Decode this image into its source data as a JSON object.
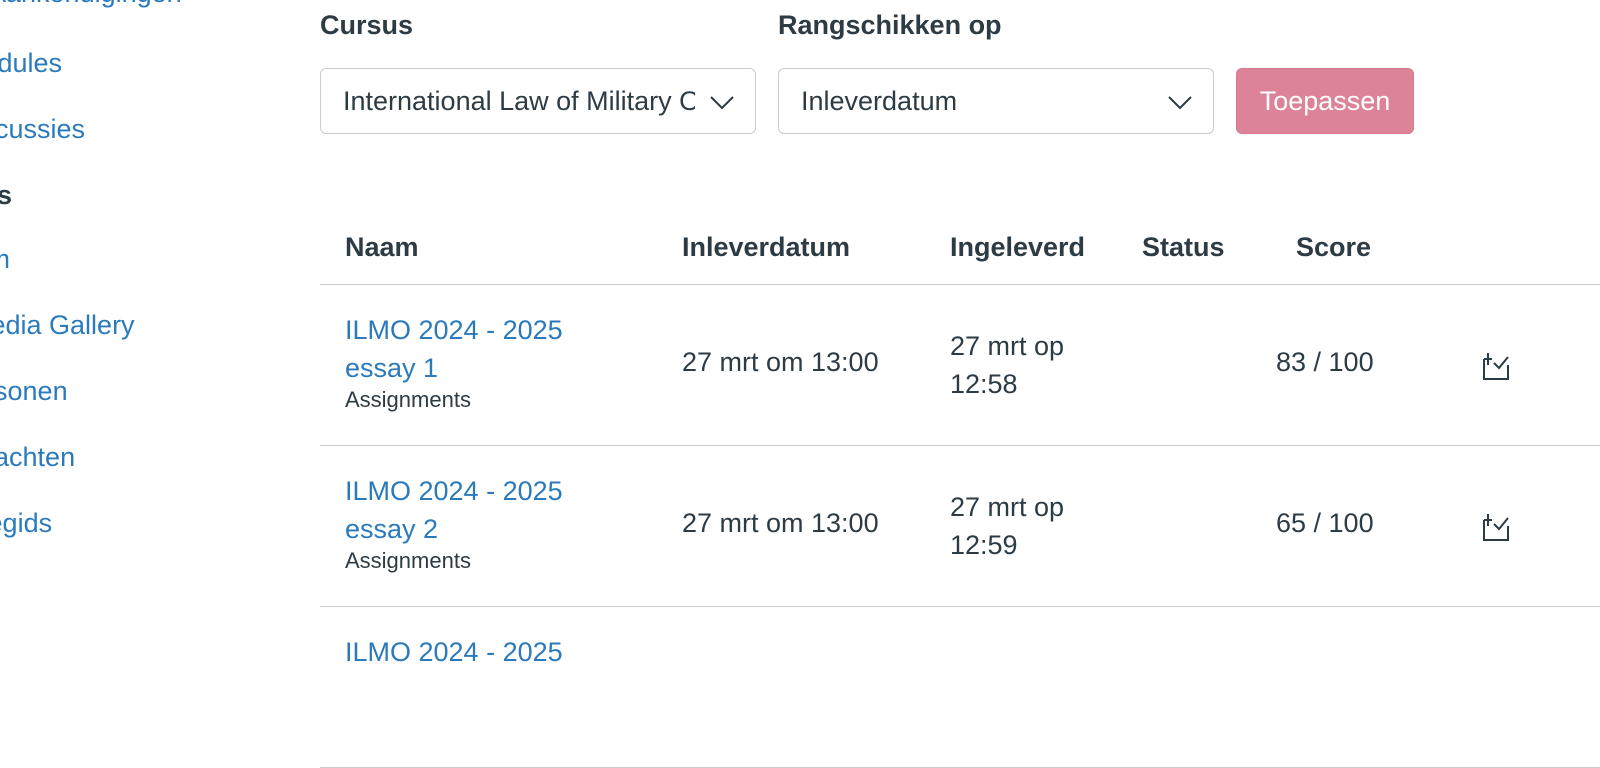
{
  "sidenav": {
    "items": [
      {
        "label": "Aankondigingen"
      },
      {
        "label": "Modules"
      },
      {
        "label": "Discussies"
      },
      {
        "label": "Cijfers"
      },
      {
        "label": "Team"
      },
      {
        "label": "Media Gallery"
      },
      {
        "label": "Personen"
      },
      {
        "label": "Opdrachten"
      },
      {
        "label": "Studiegids"
      }
    ]
  },
  "filters": {
    "course_label": "Cursus",
    "course_value": "International Law of Military Operations",
    "sort_label": "Rangschikken op",
    "sort_value": "Inleverdatum",
    "apply_label": "Toepassen"
  },
  "table": {
    "headers": [
      "Naam",
      "Inleverdatum",
      "Ingeleverd",
      "Status",
      "Score"
    ],
    "rows": [
      {
        "name": "ILMO 2024 - 2025 essay 1",
        "group": "Assignments",
        "due": "27 mrt om 13:00",
        "submitted": "27 mrt op 12:58",
        "status": "",
        "score": "83 / 100",
        "icon": "rubric-icon"
      },
      {
        "name": "ILMO 2024 - 2025 essay 2",
        "group": "Assignments",
        "due": "27 mrt om 13:00",
        "submitted": "27 mrt op 12:59",
        "status": "",
        "score": "65 / 100",
        "icon": "rubric-icon"
      },
      {
        "name": "ILMO 2024 - 2025",
        "group": "",
        "due": "",
        "submitted": "",
        "status": "",
        "score": "",
        "icon": ""
      }
    ]
  },
  "colors": {
    "link": "#2b7abc",
    "text": "#2d3b45",
    "apply": "#dc8397",
    "border": "#c7cdd1"
  }
}
